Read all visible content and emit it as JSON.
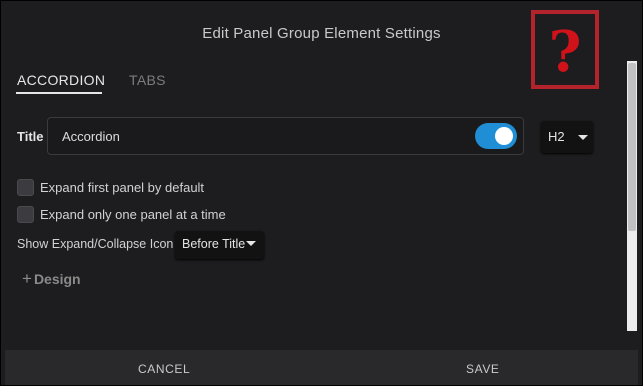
{
  "dialog": {
    "title": "Edit Panel Group Element Settings",
    "help_glyph": "?"
  },
  "tabs": [
    {
      "label": "ACCORDION",
      "active": true
    },
    {
      "label": "TABS",
      "active": false
    }
  ],
  "title_row": {
    "label": "Title",
    "value": "Accordion",
    "toggle_on": true,
    "heading_level": "H2"
  },
  "options": {
    "expand_first_label": "Expand first panel by default",
    "expand_first_checked": false,
    "expand_one_label": "Expand only one panel at a time",
    "expand_one_checked": false,
    "icon_label": "Show Expand/Collapse Icon",
    "icon_value": "Before Title"
  },
  "design": {
    "plus": "+",
    "label": "Design"
  },
  "footer": {
    "cancel_label": "CANCEL",
    "save_label": "SAVE"
  },
  "colors": {
    "background": "#1d1d1f",
    "toggle_accent": "#1f8ed4",
    "help_red": "#d0121b"
  }
}
